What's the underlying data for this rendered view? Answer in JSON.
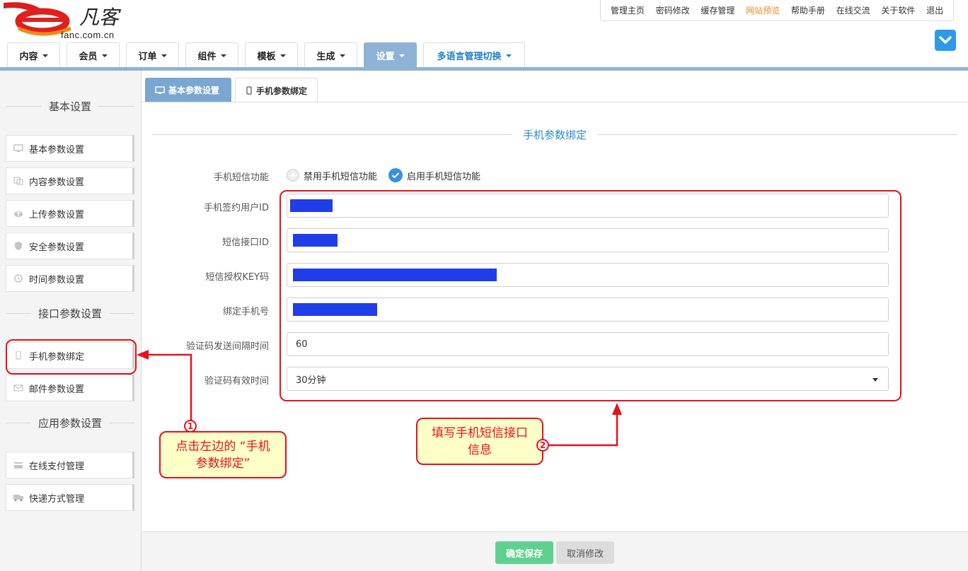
{
  "header": {
    "logo_text": "fanc.com.cn",
    "top_links": [
      "管理主页",
      "密码修改",
      "缓存管理",
      "网站预览",
      "帮助手册",
      "在线交流",
      "关于软件",
      "退出"
    ],
    "main_nav": [
      "内容",
      "会员",
      "订单",
      "组件",
      "模板",
      "生成",
      "设置",
      "多语言管理切换"
    ],
    "active_nav": "设置"
  },
  "sidebar": {
    "headings": [
      "基本设置",
      "接口参数设置",
      "应用参数设置"
    ],
    "basic_items": [
      "基本参数设置",
      "内容参数设置",
      "上传参数设置",
      "安全参数设置",
      "时间参数设置"
    ],
    "interface_items": [
      "手机参数绑定",
      "邮件参数设置"
    ],
    "app_items": [
      "在线支付管理",
      "快递方式管理"
    ]
  },
  "content": {
    "tabs": [
      "基本参数设置",
      "手机参数绑定"
    ],
    "active_tab": "手机参数绑定",
    "section_title": "手机参数绑定",
    "sms_label": "手机短信功能",
    "sms_options": [
      "禁用手机短信功能",
      "启用手机短信功能"
    ],
    "sms_selected": "启用手机短信功能",
    "fields": {
      "user_id_label": "手机签约用户ID",
      "api_id_label": "短信接口ID",
      "key_label": "短信授权KEY码",
      "phone_label": "绑定手机号",
      "interval_label": "验证码发送间隔时间",
      "interval_value": "60",
      "valid_label": "验证码有效时间",
      "valid_value": "30分钟"
    },
    "save_label": "确定保存",
    "cancel_label": "取消修改"
  },
  "annotations": {
    "callout1": "点击左边的 “手机参数绑定”",
    "callout1_line1": "点击左边的 “手机",
    "callout1_line2": "参数绑定”",
    "callout2_line1": "填写手机短信接口",
    "callout2_line2": "信息",
    "num1": "1",
    "num2": "2",
    "color": "#e8101f"
  },
  "colors": {
    "accent": "#8fb3d6",
    "link_blue": "#2d8ac8",
    "save_green": "#5fd18f",
    "redaction": "#1f3ee8"
  }
}
